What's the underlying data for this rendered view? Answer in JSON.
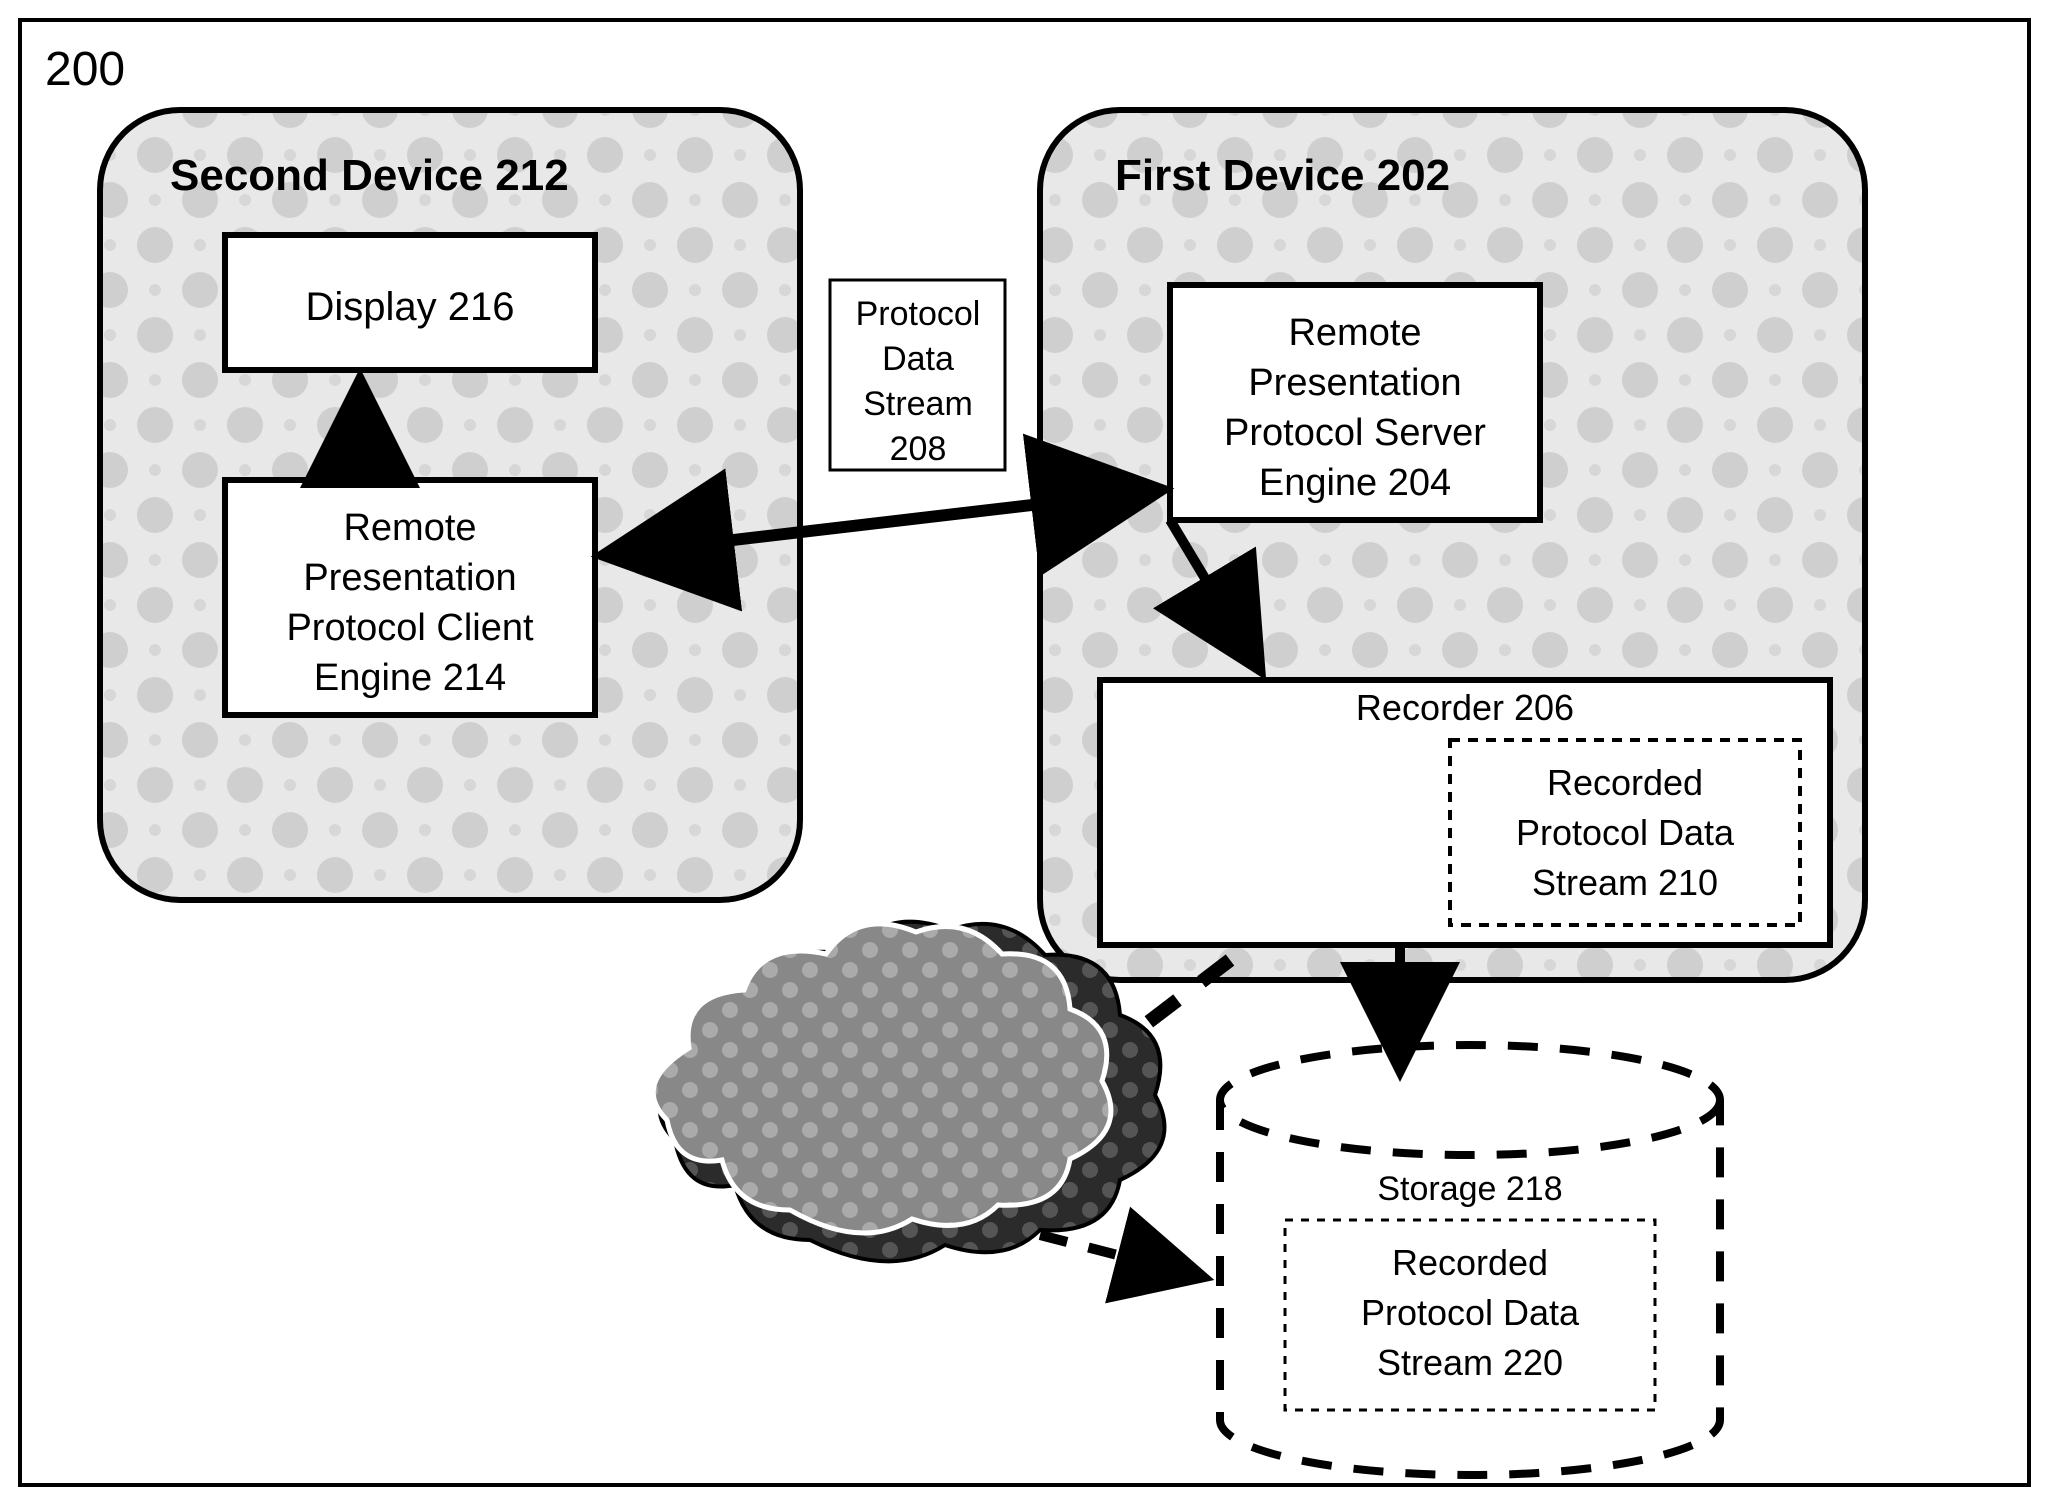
{
  "figureNumber": "200",
  "secondDevice": {
    "title": "Second Device 212"
  },
  "firstDevice": {
    "title": "First Device 202"
  },
  "display": {
    "label": "Display 216"
  },
  "clientEngine": {
    "l1": "Remote",
    "l2": "Presentation",
    "l3": "Protocol Client",
    "l4": "Engine 214"
  },
  "serverEngine": {
    "l1": "Remote",
    "l2": "Presentation",
    "l3": "Protocol Server",
    "l4": "Engine 204"
  },
  "protocolStream": {
    "l1": "Protocol",
    "l2": "Data",
    "l3": "Stream",
    "l4": "208"
  },
  "recorder": {
    "title": "Recorder 206"
  },
  "recordedStream210": {
    "l1": "Recorded",
    "l2": "Protocol Data",
    "l3": "Stream 210"
  },
  "storage": {
    "title": "Storage 218"
  },
  "recordedStream220": {
    "l1": "Recorded",
    "l2": "Protocol Data",
    "l3": "Stream 220"
  }
}
